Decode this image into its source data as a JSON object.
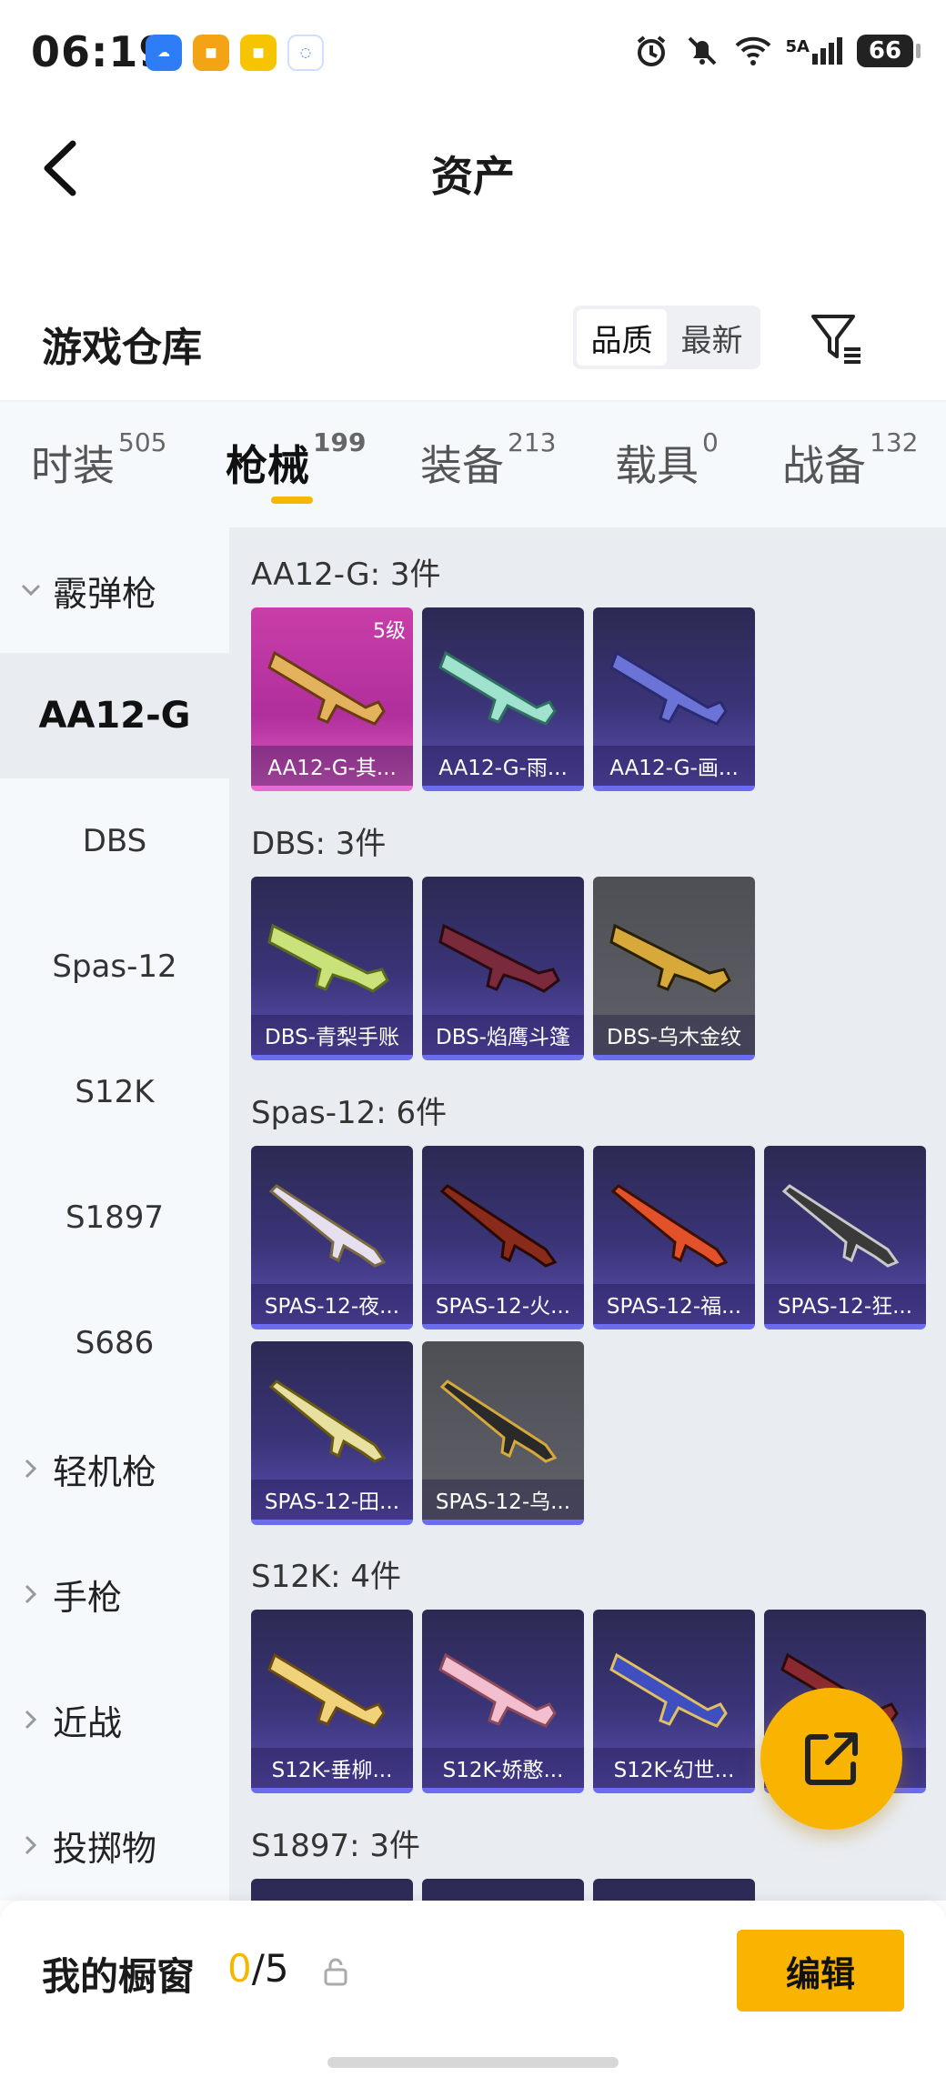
{
  "status_bar": {
    "time": "06:19",
    "network": "5A",
    "battery": "66"
  },
  "header": {
    "title": "资产"
  },
  "section": {
    "title": "游戏仓库",
    "sort_options": [
      "品质",
      "最新"
    ],
    "sort_active": "品质"
  },
  "tabs": [
    {
      "label": "时装",
      "count": "505"
    },
    {
      "label": "枪械",
      "count": "199",
      "active": true
    },
    {
      "label": "装备",
      "count": "213"
    },
    {
      "label": "载具",
      "count": "0"
    },
    {
      "label": "战备",
      "count": "132"
    }
  ],
  "sidebar": {
    "categories": [
      {
        "label": "霰弹枪",
        "expanded": true
      },
      {
        "label": "AA12-G",
        "selected": true
      },
      {
        "label": "DBS"
      },
      {
        "label": "Spas-12"
      },
      {
        "label": "S12K"
      },
      {
        "label": "S1897"
      },
      {
        "label": "S686"
      },
      {
        "label": "轻机枪"
      },
      {
        "label": "手枪"
      },
      {
        "label": "近战"
      },
      {
        "label": "投掷物"
      }
    ]
  },
  "groups": [
    {
      "title": "AA12-G: 3件",
      "items": [
        {
          "label": "AA12-G-其...",
          "level": "5级",
          "tier": "gold"
        },
        {
          "label": "AA12-G-雨...",
          "tier": "purple"
        },
        {
          "label": "AA12-G-画...",
          "tier": "purple"
        }
      ]
    },
    {
      "title": "DBS: 3件",
      "items": [
        {
          "label": "DBS-青梨手账",
          "tier": "purple"
        },
        {
          "label": "DBS-焰鹰斗篷",
          "tier": "purple"
        },
        {
          "label": "DBS-乌木金纹",
          "tier": "grey"
        }
      ]
    },
    {
      "title": "Spas-12: 6件",
      "items": [
        {
          "label": "SPAS-12-夜...",
          "tier": "purple"
        },
        {
          "label": "SPAS-12-火...",
          "tier": "purple"
        },
        {
          "label": "SPAS-12-福...",
          "tier": "purple"
        },
        {
          "label": "SPAS-12-狂...",
          "tier": "purple"
        },
        {
          "label": "SPAS-12-田...",
          "tier": "purple"
        },
        {
          "label": "SPAS-12-乌...",
          "tier": "grey"
        }
      ]
    },
    {
      "title": "S12K: 4件",
      "items": [
        {
          "label": "S12K-垂柳...",
          "tier": "purple"
        },
        {
          "label": "S12K-娇憨...",
          "tier": "purple"
        },
        {
          "label": "S12K-幻世...",
          "tier": "purple"
        },
        {
          "label": "",
          "tier": "purple"
        }
      ]
    },
    {
      "title": "S1897: 3件",
      "items": []
    }
  ],
  "bottom": {
    "title": "我的橱窗",
    "count_used": "0",
    "count_sep": "/",
    "count_total": "5",
    "edit_label": "编辑"
  },
  "colors": {
    "accent": "#f8b400",
    "purple_card": "#3a3478",
    "gold_card": "#c93ea8",
    "grey_card": "#595a61"
  }
}
